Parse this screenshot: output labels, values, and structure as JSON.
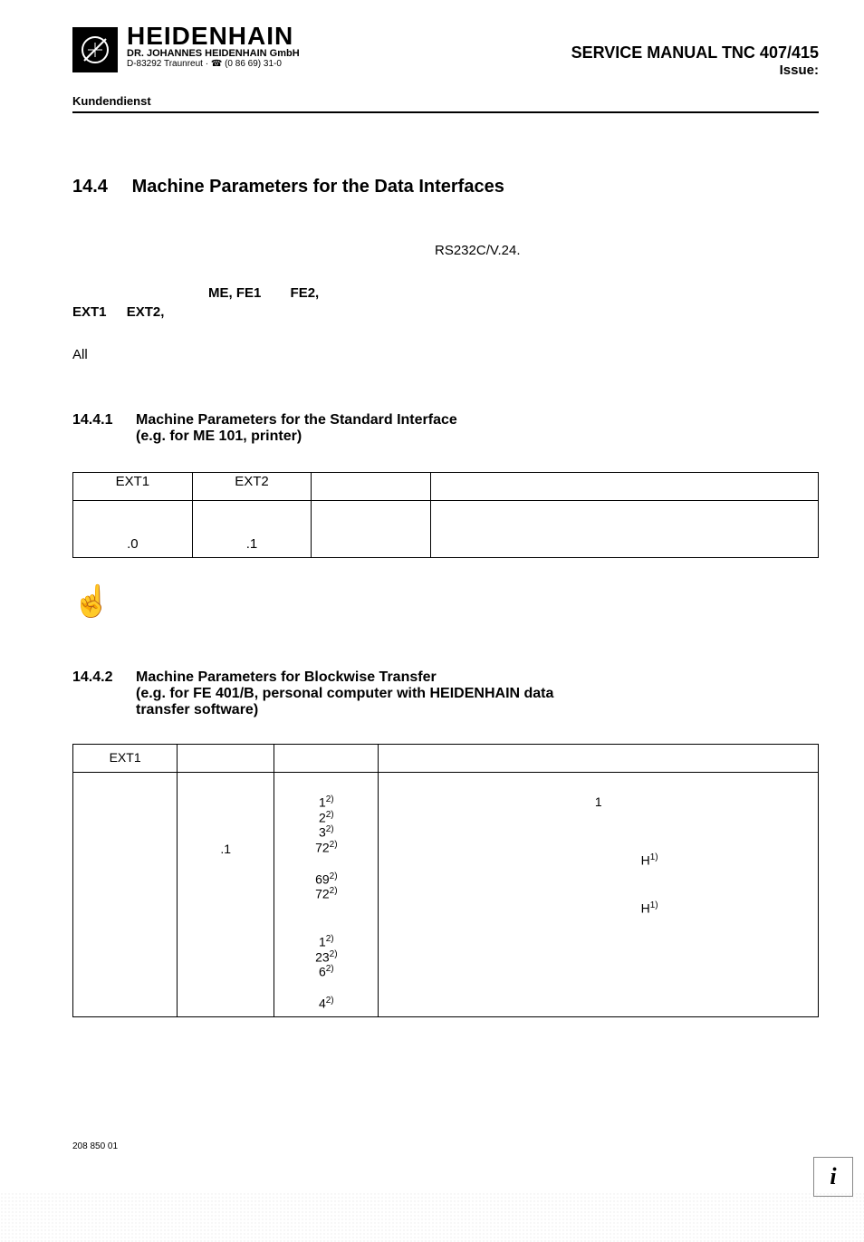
{
  "header": {
    "brand": "HEIDENHAIN",
    "subsidiary": "DR. JOHANNES HEIDENHAIN GmbH",
    "address_prefix": "D-83292 Traunreut ·",
    "phone": "(0 86 69) 31-0",
    "manual_title": "SERVICE MANUAL TNC 407/415",
    "issue": "Issue:",
    "kundendienst": "Kundendienst"
  },
  "section": {
    "num": "14.4",
    "title": "Machine Parameters for the Data Interfaces"
  },
  "rs_line": "RS232C/V.24.",
  "modes": {
    "me_fe1": "ME, FE1",
    "fe2": "FE2,",
    "ext1": "EXT1",
    "ext2": "EXT2,",
    "all": "All"
  },
  "sub1": {
    "num": "14.4.1",
    "title_line1": "Machine Parameters for the Standard Interface",
    "title_line2": "(e.g. for ME 101, printer)"
  },
  "table1": {
    "h1": "EXT1",
    "h2": "EXT2",
    "r1": ".0",
    "r2": ".1"
  },
  "sub2": {
    "num": "14.4.2",
    "title_line1": "Machine Parameters for Blockwise Transfer",
    "title_line2": "(e.g. for FE 401/B, personal computer with HEIDENHAIN data",
    "title_line3": "transfer software)"
  },
  "table2": {
    "h1": "EXT1",
    "col2_row": ".1",
    "col3": {
      "g1_1": "1",
      "g1_1_sup": "2)",
      "g1_2": "2",
      "g1_2_sup": "2)",
      "g1_3": "3",
      "g1_3_sup": "2)",
      "g1_4": "72",
      "g1_4_sup": "2)",
      "g2_1": "69",
      "g2_1_sup": "2)",
      "g2_2": "72",
      "g2_2_sup": "2)",
      "g3_1": "1",
      "g3_1_sup": "2)",
      "g3_2": "23",
      "g3_2_sup": "2)",
      "g3_3": "6",
      "g3_3_sup": "2)",
      "g4_1": "4",
      "g4_1_sup": "2)"
    },
    "col4": {
      "one": "1",
      "H": "H",
      "H_sup": "1)"
    }
  },
  "footer_code": "208 850 01",
  "info_char": "i"
}
